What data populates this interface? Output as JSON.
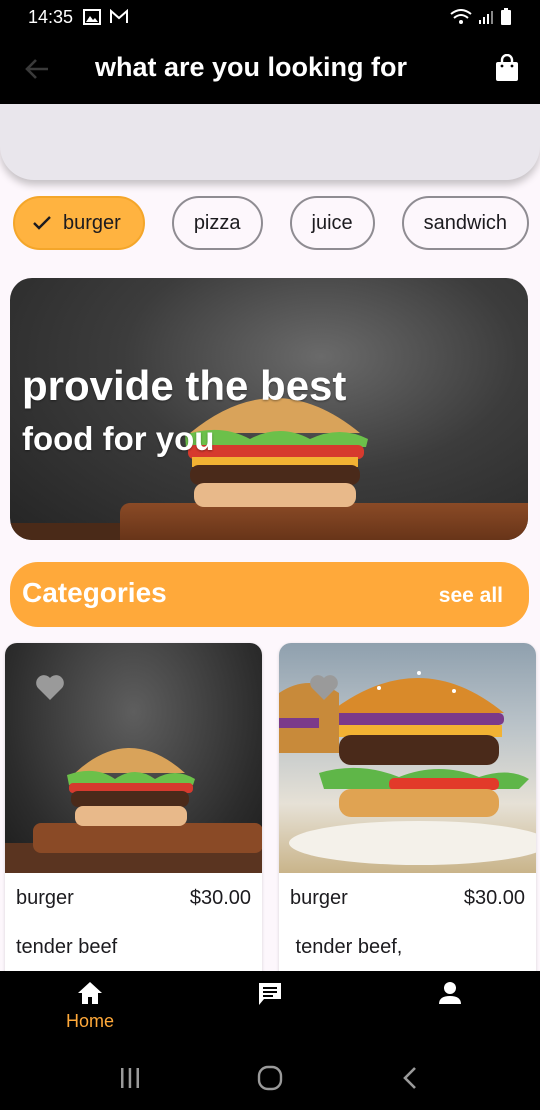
{
  "status": {
    "time": "14:35"
  },
  "app_bar": {
    "title": "what are you looking for"
  },
  "search": {
    "placeholder": "",
    "value": ""
  },
  "chips": [
    {
      "label": "burger",
      "selected": true
    },
    {
      "label": "pizza",
      "selected": false
    },
    {
      "label": "juice",
      "selected": false
    },
    {
      "label": "sandwich",
      "selected": false
    }
  ],
  "hero": {
    "line1": "provide the best",
    "line2": "food for you"
  },
  "categories": {
    "label": "Categories",
    "see_all": "see all"
  },
  "cards": [
    {
      "name": "burger",
      "price": "$30.00",
      "description": "tender beef"
    },
    {
      "name": "burger",
      "price": "$30.00",
      "description": " tender beef,"
    }
  ],
  "bottom_nav": {
    "home_label": "Home",
    "active": "home"
  },
  "colors": {
    "accent": "#ffa93a",
    "chip_selected": "#ffb340",
    "bar": "#000000",
    "background": "#fdf7fc"
  },
  "icons": [
    "back-arrow-icon",
    "shopping-bag-icon",
    "check-icon",
    "heart-icon",
    "home-icon",
    "chat-icon",
    "person-icon",
    "recent-apps-icon",
    "home-circle-icon",
    "back-chevron-icon"
  ]
}
